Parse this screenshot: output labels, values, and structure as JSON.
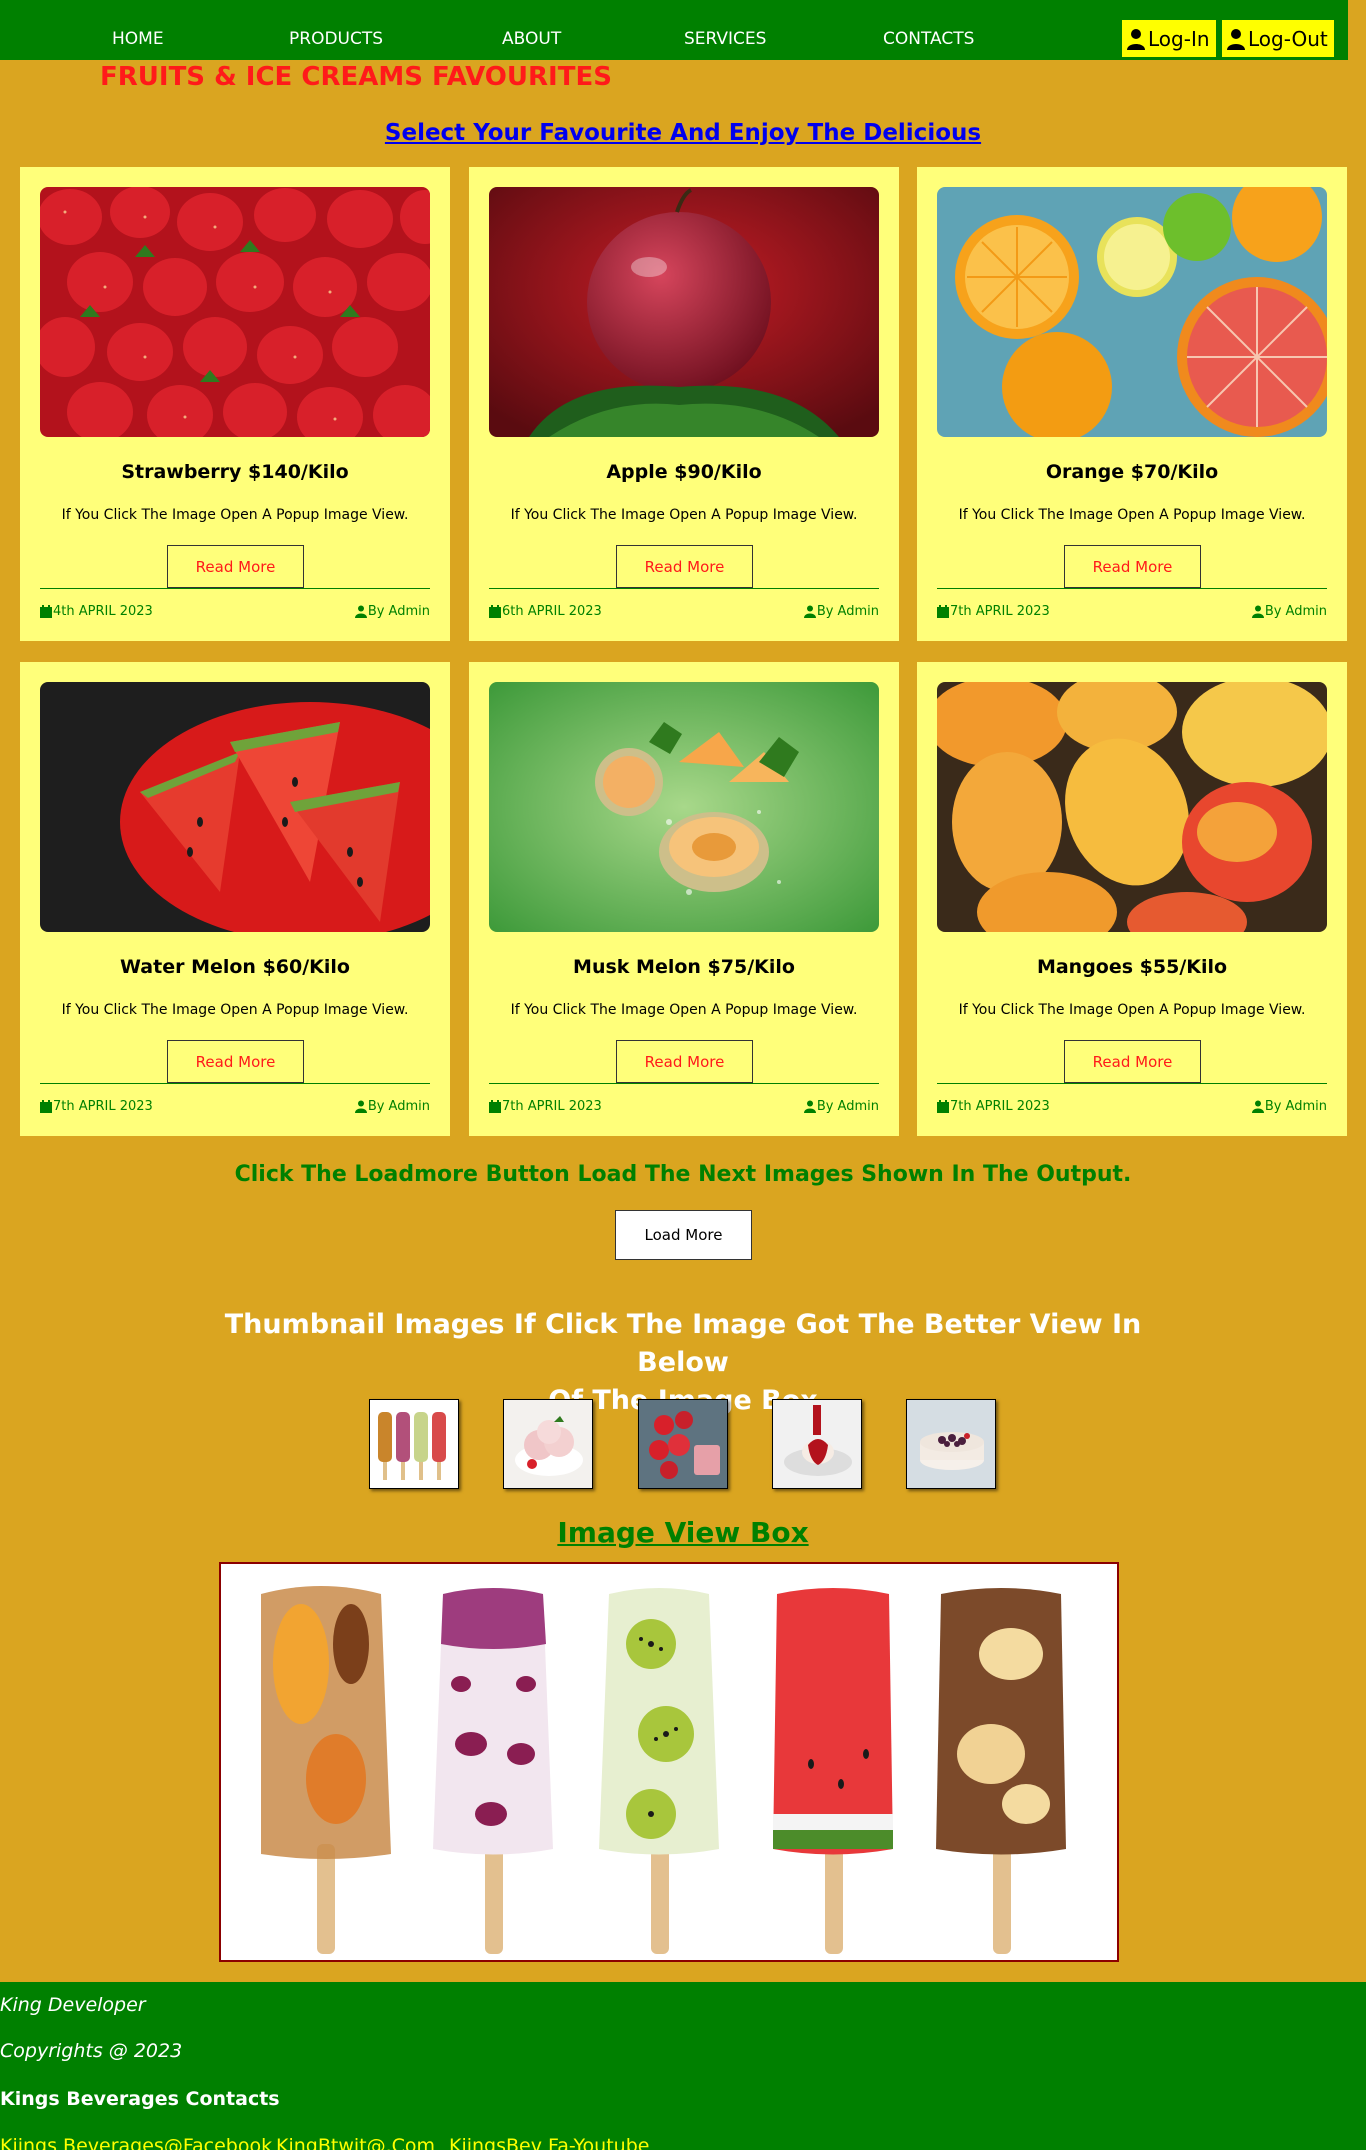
{
  "nav": {
    "items": [
      {
        "label": "HOME"
      },
      {
        "label": "PRODUCTS"
      },
      {
        "label": "ABOUT"
      },
      {
        "label": "SERVICES"
      },
      {
        "label": "CONTACTS"
      }
    ],
    "login_label": "Log-In",
    "logout_label": "Log-Out",
    "user_icon": "user-icon"
  },
  "page": {
    "title": "FRUITS & ICE CREAMS FAVOURITES",
    "subtitle": "Select Your Favourite And Enjoy The Delicious"
  },
  "cards": [
    {
      "title": "Strawberry $140/Kilo",
      "text": "If You Click The Image Open A Popup Image View.",
      "button": "Read More",
      "date": "4th APRIL 2023",
      "author": "By Admin",
      "image": "strawberries"
    },
    {
      "title": "Apple $90/Kilo",
      "text": "If You Click The Image Open A Popup Image View.",
      "button": "Read More",
      "date": "6th APRIL 2023",
      "author": "By Admin",
      "image": "apple"
    },
    {
      "title": "Orange $70/Kilo",
      "text": "If You Click The Image Open A Popup Image View.",
      "button": "Read More",
      "date": "7th APRIL 2023",
      "author": "By Admin",
      "image": "citrus"
    },
    {
      "title": "Water Melon $60/Kilo",
      "text": "If You Click The Image Open A Popup Image View.",
      "button": "Read More",
      "date": "7th APRIL 2023",
      "author": "By Admin",
      "image": "watermelon"
    },
    {
      "title": "Musk Melon $75/Kilo",
      "text": "If You Click The Image Open A Popup Image View.",
      "button": "Read More",
      "date": "7th APRIL 2023",
      "author": "By Admin",
      "image": "musk-melon"
    },
    {
      "title": "Mangoes $55/Kilo",
      "text": "If You Click The Image Open A Popup Image View.",
      "button": "Read More",
      "date": "7th APRIL 2023",
      "author": "By Admin",
      "image": "mangoes"
    }
  ],
  "loadmore": {
    "text": "Click The Loadmore Button Load The Next Images Shown In The Output.",
    "button": "Load More"
  },
  "thumbnails": {
    "heading_line1": "Thumbnail Images If Click The Image Got The Better View In Below",
    "heading_line2": "Of The Image Box",
    "items": [
      "ice-pops",
      "ice-cream-bowl",
      "strawberry-dessert",
      "dessert-plate",
      "berry-cake"
    ]
  },
  "view_box": {
    "heading": "Image View Box",
    "image": "fruit-popsicles"
  },
  "footer": {
    "developer": "King Developer",
    "copyright": "Copyrights @ 2023",
    "contacts_heading": "Kings Beverages Contacts",
    "links": [
      {
        "label": "Kiings Beverages@Facebook"
      },
      {
        "label": "KingBtwit@.Com"
      },
      {
        "label": "KiingsBev Fa-Youtube"
      }
    ]
  },
  "colors": {
    "background": "#daa520",
    "nav": "#008000",
    "card": "#ffff7a",
    "title_red": "#ff1a1a",
    "accent_yellow": "#ffff00"
  }
}
